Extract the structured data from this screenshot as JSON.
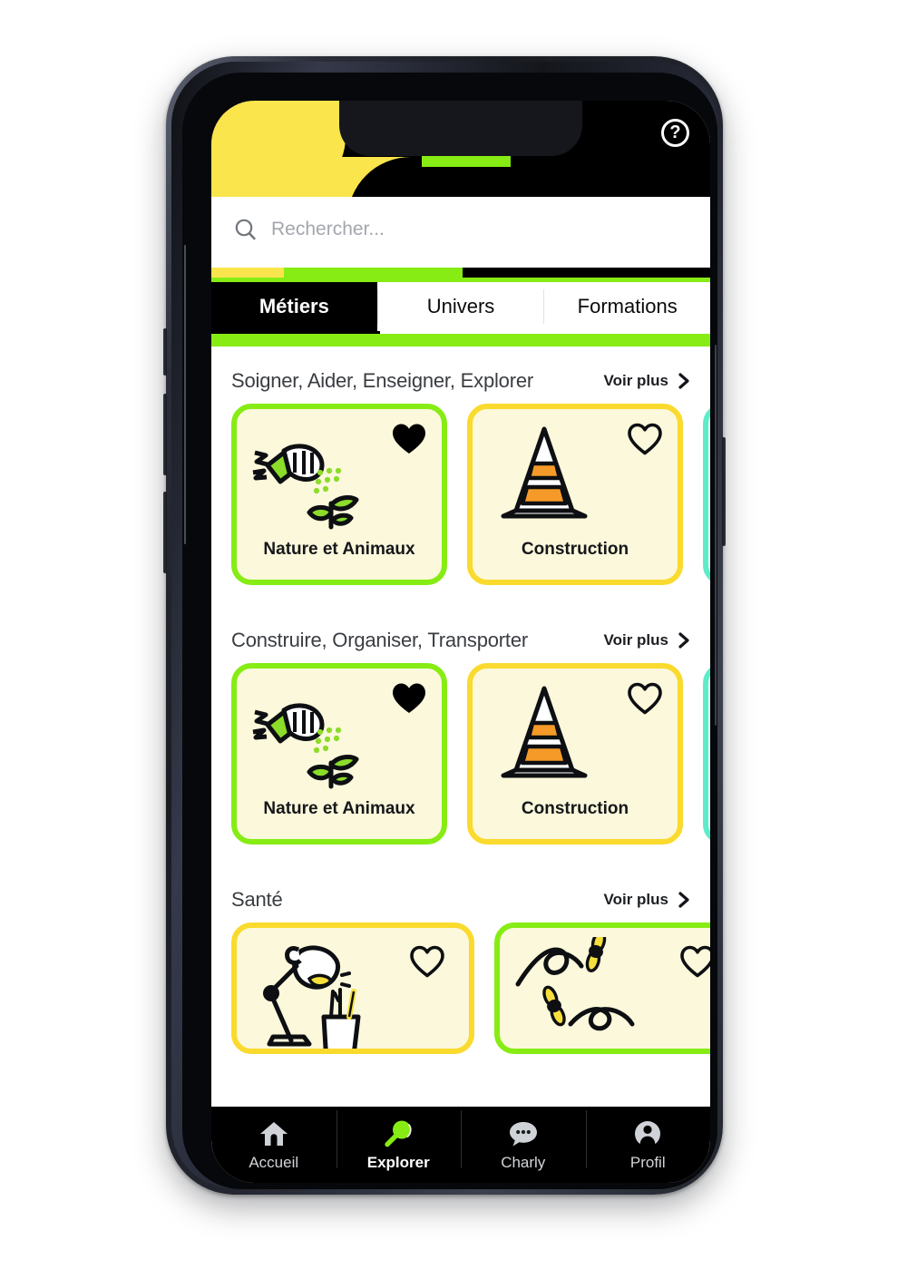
{
  "theme": {
    "yellow": "#fae54c",
    "green": "#86ec14",
    "card_cream": "#fbf8db",
    "card_yellow_border": "#fada2d",
    "card_cyan_border": "#5eecc8",
    "card_cyan_fill": "#e9fdfa",
    "black": "#000000",
    "orange": "#f59a28"
  },
  "header": {
    "help_icon": "question-mark-circle-icon",
    "help_label": "?"
  },
  "search": {
    "icon": "search-icon",
    "value": "",
    "placeholder": "Rechercher..."
  },
  "tabs": [
    {
      "label": "Métiers",
      "active": true
    },
    {
      "label": "Univers",
      "active": false
    },
    {
      "label": "Formations",
      "active": false
    }
  ],
  "voir_plus_label": "Voir plus",
  "sections": [
    {
      "title": "Soigner, Aider, Enseigner, Explorer",
      "more_label": "Voir plus",
      "cards": [
        {
          "label": "Nature et Animaux",
          "icon": "watering-hand-plant-icon",
          "border": "green",
          "favorited": true
        },
        {
          "label": "Construction",
          "icon": "traffic-cone-icon",
          "border": "yellow",
          "favorited": false
        },
        {
          "label": "",
          "icon": "",
          "border": "cyan",
          "favorited": false
        }
      ]
    },
    {
      "title": "Construire, Organiser, Transporter",
      "more_label": "Voir plus",
      "cards": [
        {
          "label": "Nature et Animaux",
          "icon": "watering-hand-plant-icon",
          "border": "green",
          "favorited": true
        },
        {
          "label": "Construction",
          "icon": "traffic-cone-icon",
          "border": "yellow",
          "favorited": false
        },
        {
          "label": "",
          "icon": "",
          "border": "cyan",
          "favorited": false
        }
      ]
    },
    {
      "title": "Santé",
      "more_label": "Voir plus",
      "cards": [
        {
          "label": "",
          "icon": "desk-lamp-pencils-icon",
          "border": "yellow",
          "favorited": false
        },
        {
          "label": "",
          "icon": "flying-bees-icon",
          "border": "green",
          "favorited": false
        }
      ]
    }
  ],
  "bottom_nav": [
    {
      "label": "Accueil",
      "icon": "home-icon",
      "active": false
    },
    {
      "label": "Explorer",
      "icon": "magnifier-icon",
      "active": true
    },
    {
      "label": "Charly",
      "icon": "chat-bubble-icon",
      "active": false
    },
    {
      "label": "Profil",
      "icon": "person-avatar-icon",
      "active": false
    }
  ]
}
